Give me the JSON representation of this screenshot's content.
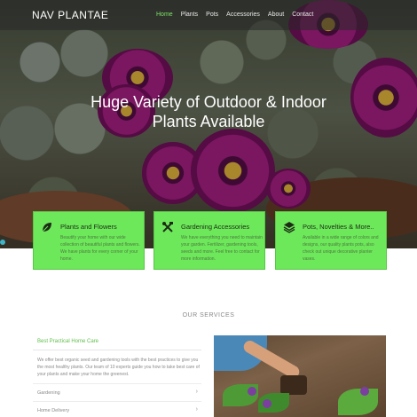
{
  "brand": "NAV PLANTAE",
  "nav": [
    "Home",
    "Plants",
    "Pots",
    "Accessories",
    "About",
    "Contact"
  ],
  "hero": {
    "title": "Huge Variety of Outdoor & Indoor Plants Available"
  },
  "cards": [
    {
      "title": "Plants and Flowers",
      "icon": "leaf-icon",
      "desc": "Beautify your home with our wide collection of beautiful plants and flowers. We have plants for every corner of your home."
    },
    {
      "title": "Gardening Accessories",
      "icon": "tools-icon",
      "desc": "We have everything you need to maintain your garden. Fertilizer, gardening tools, seeds and more. Feel free to contact for more information."
    },
    {
      "title": "Pots, Novelties & More..",
      "icon": "layers-icon",
      "desc": "Available in a wide range of colors and designs, our quality plants pots, also check out unique decorative planter vases."
    }
  ],
  "services": {
    "title": "OUR SERVICES",
    "open_item": "Best Practical Home Care",
    "open_text": "We offer best organic seed and gardening tools with the best practices to give you the most healthy plants. Our team of 10 experts guide you how to take best care of your plants and make your home the greenest.",
    "items": [
      "Gardening",
      "Home Delivery"
    ]
  },
  "colors": {
    "accent": "#6de85a",
    "nav_active": "#7ee06a"
  }
}
